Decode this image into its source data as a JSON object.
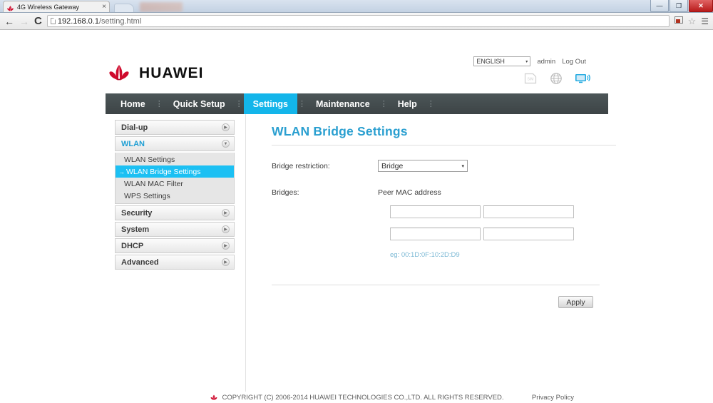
{
  "browser": {
    "tab_title": "4G Wireless Gateway",
    "tab_close": "×",
    "favicon": "huawei-flower-icon",
    "back": "←",
    "forward": "→",
    "reload": "C",
    "url_host": "192.168.0.1",
    "url_path": "/setting.html",
    "toolbar_icon": "cast-icon",
    "star_icon": "☆",
    "menu_icon": "☰",
    "minimize": "—",
    "maximize": "❐",
    "close": "✕"
  },
  "header": {
    "brand": "HUAWEI",
    "language": "ENGLISH",
    "language_caret": "▾",
    "user": "admin",
    "logout": "Log Out",
    "status_icons": [
      "sim-card-icon",
      "globe-icon",
      "monitor-signal-icon"
    ]
  },
  "nav": {
    "items": [
      {
        "label": "Home",
        "active": false
      },
      {
        "label": "Quick Setup",
        "active": false
      },
      {
        "label": "Settings",
        "active": true
      },
      {
        "label": "Maintenance",
        "active": false
      },
      {
        "label": "Help",
        "active": false
      }
    ],
    "separator": "⋮"
  },
  "sidebar": {
    "groups": [
      {
        "label": "Dial-up",
        "open": false,
        "icon": "chevron-right-icon",
        "icon_glyph": "▶"
      },
      {
        "label": "WLAN",
        "open": true,
        "icon": "chevron-down-icon",
        "icon_glyph": "▼"
      },
      {
        "label": "Security",
        "open": false,
        "icon": "chevron-right-icon",
        "icon_glyph": "▶"
      },
      {
        "label": "System",
        "open": false,
        "icon": "chevron-right-icon",
        "icon_glyph": "▶"
      },
      {
        "label": "DHCP",
        "open": false,
        "icon": "chevron-right-icon",
        "icon_glyph": "▶"
      },
      {
        "label": "Advanced",
        "open": false,
        "icon": "chevron-right-icon",
        "icon_glyph": "▶"
      }
    ],
    "wlan_items": [
      {
        "label": "WLAN Settings",
        "active": false
      },
      {
        "label": "WLAN Bridge Settings",
        "active": true,
        "arrow": "→"
      },
      {
        "label": "WLAN MAC Filter",
        "active": false
      },
      {
        "label": "WPS Settings",
        "active": false
      }
    ]
  },
  "main": {
    "title": "WLAN Bridge Settings",
    "bridge_restriction_label": "Bridge restriction:",
    "bridge_restriction_value": "Bridge",
    "bridge_restriction_caret": "▾",
    "bridges_label": "Bridges:",
    "peer_mac_header": "Peer MAC address",
    "mac_fields": [
      "",
      "",
      "",
      ""
    ],
    "mac_placeholder": "",
    "hint": "eg: 00:1D:0F:10:2D:D9",
    "apply_label": "Apply"
  },
  "footer": {
    "copyright": "COPYRIGHT (C) 2006-2014 HUAWEI TECHNOLOGIES CO.,LTD. ALL RIGHTS RESERVED.",
    "privacy": "Privacy Policy",
    "mark": "huawei-flower-icon"
  },
  "colors": {
    "accent": "#13b5ea",
    "title": "#2a9fd0",
    "navbar": "#3d4446",
    "brand_red": "#cf0a2c",
    "hint": "#7ab8d4"
  }
}
